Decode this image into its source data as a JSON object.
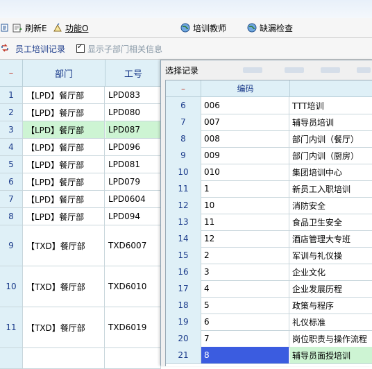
{
  "toolbar": {
    "edit_label": "",
    "refresh_label": "刷新E",
    "function_label": "功能O",
    "trainer_label": "培训教师",
    "missing_check_label": "缺漏检查"
  },
  "subbar": {
    "employee_training_label": "员工培训记录",
    "show_sub_dept_label": "显示子部门相关信息",
    "show_sub_dept_checked": true
  },
  "main_grid": {
    "headers": {
      "row_marker": "–",
      "department": "部门",
      "code": "工号"
    },
    "rows": [
      {
        "no": "1",
        "department": "【LPD】餐厅部",
        "code": "LPD083"
      },
      {
        "no": "2",
        "department": "【LPD】餐厅部",
        "code": "LPD080"
      },
      {
        "no": "3",
        "department": "【LPD】餐厅部",
        "code": "LPD087",
        "selected": true
      },
      {
        "no": "4",
        "department": "【LPD】餐厅部",
        "code": "LPD096"
      },
      {
        "no": "5",
        "department": "【LPD】餐厅部",
        "code": "LPD081"
      },
      {
        "no": "6",
        "department": "【LPD】餐厅部",
        "code": "LPD079"
      },
      {
        "no": "7",
        "department": "【LPD】餐厅部",
        "code": "LPD0604"
      },
      {
        "no": "8",
        "department": "【LPD】餐厅部",
        "code": "LPD094"
      },
      {
        "no": "9",
        "department": "【TXD】餐厅部",
        "code": "TXD6007"
      },
      {
        "no": "10",
        "department": "【TXD】餐厅部",
        "code": "TXD6010"
      },
      {
        "no": "11",
        "department": "【TXD】餐厅部",
        "code": "TXD6019"
      },
      {
        "no": "",
        "department": "",
        "code": ""
      }
    ]
  },
  "dialog": {
    "title": "选择记录",
    "headers": {
      "row_marker": "–",
      "code": "编码",
      "name": ""
    },
    "rows": [
      {
        "no": "6",
        "code": "006",
        "name": "TTT培训"
      },
      {
        "no": "7",
        "code": "007",
        "name": "辅导员培训"
      },
      {
        "no": "8",
        "code": "008",
        "name": "部门内训（餐厅）"
      },
      {
        "no": "9",
        "code": "009",
        "name": "部门内训（厨房）"
      },
      {
        "no": "10",
        "code": "010",
        "name": "集团培训中心"
      },
      {
        "no": "11",
        "code": "1",
        "name": "新员工入职培训"
      },
      {
        "no": "12",
        "code": "10",
        "name": "消防安全"
      },
      {
        "no": "13",
        "code": "11",
        "name": "食品卫生安全"
      },
      {
        "no": "14",
        "code": "12",
        "name": "酒店管理大专班"
      },
      {
        "no": "15",
        "code": "2",
        "name": "军训与礼仪操"
      },
      {
        "no": "16",
        "code": "3",
        "name": "企业文化"
      },
      {
        "no": "17",
        "code": "4",
        "name": "企业发展历程"
      },
      {
        "no": "18",
        "code": "5",
        "name": "政策与程序"
      },
      {
        "no": "19",
        "code": "6",
        "name": "礼仪标准"
      },
      {
        "no": "20",
        "code": "7",
        "name": "岗位职责与操作流程"
      },
      {
        "no": "21",
        "code": "8",
        "name": "辅导员面授培训",
        "highlighted": true
      }
    ]
  },
  "colors": {
    "header_bg": "#dff0f7",
    "selected_row": "#cdf4d3",
    "highlight_cell": "#3b5ce0",
    "header_text": "#1a3a8a"
  }
}
